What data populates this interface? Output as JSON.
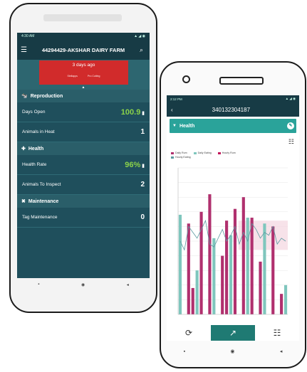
{
  "phone1": {
    "title": "44294429-AKSHAR DAIRY FARM",
    "banner": {
      "text": "3 days ago",
      "brand": "Stellapps",
      "tag": "Pro Cutting"
    },
    "sections": [
      {
        "label": "Reproduction",
        "icon": "cow-icon",
        "rows": [
          {
            "label": "Days Open",
            "value": "100.9",
            "style": "green",
            "icon": "trash-icon"
          },
          {
            "label": "Animals in Heat",
            "value": "1",
            "style": "white"
          }
        ]
      },
      {
        "label": "Health",
        "icon": "medical-bag-icon",
        "rows": [
          {
            "label": "Health Rate",
            "value": "96%",
            "style": "green",
            "icon": "trash-icon"
          },
          {
            "label": "Animals To Inspect",
            "value": "2",
            "style": "white"
          }
        ]
      },
      {
        "label": "Maintenance",
        "icon": "tools-icon",
        "rows": [
          {
            "label": "Tag Maintenance",
            "value": "0",
            "style": "white"
          }
        ]
      }
    ]
  },
  "phone2": {
    "title": "340132304187",
    "section_title": "Health",
    "legend": [
      "Daily Rum",
      "Daily Eating",
      "Hourly Rum",
      "Hourly Eating"
    ]
  },
  "colors": {
    "teal_dark": "#173b45",
    "teal": "#2a5e69",
    "accent": "#2aa39a",
    "red": "#d12b2b",
    "green": "#8ad14a",
    "magenta": "#b0306e"
  },
  "chart_data": {
    "type": "bar",
    "series": [
      {
        "name": "Daily Rum",
        "values": [
          0,
          0,
          62,
          18,
          0,
          70,
          0,
          82,
          0,
          0,
          40,
          64,
          0,
          72,
          0,
          80,
          0,
          66,
          0,
          36,
          0,
          0,
          60,
          0,
          14,
          0
        ]
      },
      {
        "name": "Daily Eating",
        "values": [
          68,
          0,
          0,
          0,
          30,
          0,
          0,
          0,
          52,
          0,
          0,
          0,
          54,
          0,
          0,
          0,
          66,
          0,
          0,
          0,
          62,
          0,
          0,
          0,
          0,
          20
        ]
      },
      {
        "name": "Hourly Rum",
        "values": [
          50,
          44,
          60,
          56,
          52,
          58,
          64,
          48,
          46,
          52,
          58,
          50,
          54,
          60,
          48,
          56,
          50,
          62,
          58,
          52,
          56,
          54,
          60,
          48,
          52,
          50
        ]
      }
    ],
    "ylim": [
      0,
      100
    ]
  }
}
